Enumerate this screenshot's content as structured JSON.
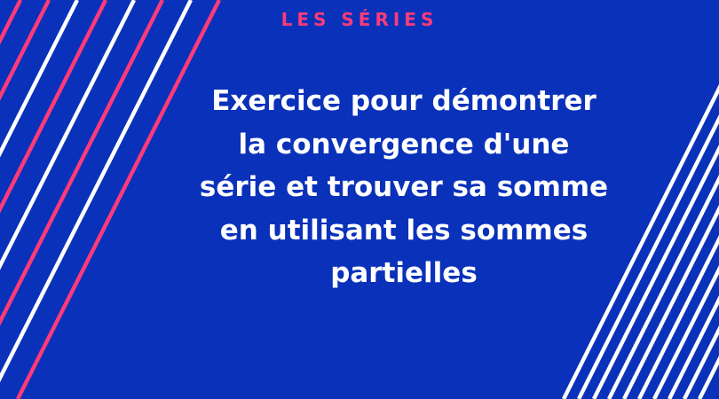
{
  "banner": {
    "category": "LES SÉRIES",
    "title_lines": [
      "Exercice pour démontrer",
      "la convergence d'une",
      "série et trouver sa somme",
      "en utilisant les sommes",
      "partielles"
    ]
  },
  "colors": {
    "background": "#0a31b9",
    "accent_pink": "#ff3a78",
    "stripe_white": "#ffffff",
    "text_white": "#ffffff"
  }
}
